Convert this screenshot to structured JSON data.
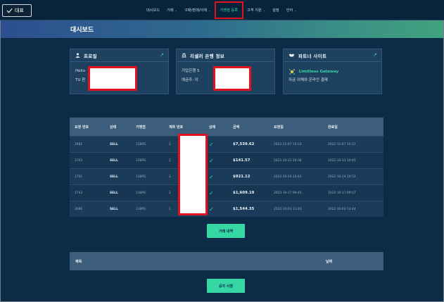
{
  "nav": {
    "brand": "대표",
    "items": [
      {
        "label": "대시보드",
        "caret": ""
      },
      {
        "label": "거래",
        "caret": "⌄"
      },
      {
        "label": "구매/판매/이체",
        "caret": "⌄"
      },
      {
        "label": "가맹점 등록",
        "caret": ""
      },
      {
        "label": "고객 지원",
        "caret": "⌄"
      },
      {
        "label": "설정",
        "caret": ""
      },
      {
        "label": "언어",
        "caret": "⌄"
      }
    ]
  },
  "hero": {
    "title": "대시보드"
  },
  "cards": {
    "profile": {
      "title": "프로필",
      "line1": "Hello",
      "line2": "TU 판"
    },
    "bank": {
      "title": "리셀러 은행 정보",
      "line1": "기업은행 5",
      "line2": "예금주: 이"
    },
    "partner": {
      "title": "파트너 사이트",
      "name": "Limitless Gateway",
      "desc": "자금 이체와 온라인 결제"
    }
  },
  "table": {
    "headers": [
      "요청 번호",
      "상태",
      "가맹점",
      "계좌 번호",
      "상태",
      "금액",
      "요청일",
      "완료일"
    ],
    "rows": [
      {
        "id": "2881",
        "status": "SELL",
        "merchant": "138PG",
        "acct": "2",
        "amount": "$7,539.62",
        "requested": "2022-11-07 10:33",
        "completed": "2022-11-07 10:37"
      },
      {
        "id": "2763",
        "status": "SELL",
        "merchant": "138PG",
        "acct": "2",
        "amount": "$141.57",
        "requested": "2022-10-31 10:38",
        "completed": "2022-10-31 10:45"
      },
      {
        "id": "2701",
        "status": "SELL",
        "merchant": "138PG",
        "acct": "2",
        "amount": "$921.12",
        "requested": "2022-10-24 10:43",
        "completed": "2022-10-24 10:52"
      },
      {
        "id": "2743",
        "status": "SELL",
        "merchant": "138PG",
        "acct": "2",
        "amount": "$1,609.19",
        "requested": "2022-10-17 09:45",
        "completed": "2022-10-17 09:57"
      },
      {
        "id": "2686",
        "status": "SELL",
        "merchant": "138PG",
        "acct": "2",
        "amount": "$1,544.35",
        "requested": "2022-10-03 13:43",
        "completed": "2022-10-03 13:44"
      }
    ]
  },
  "buttons": {
    "history": "거래 내역",
    "notices": "공지 사항"
  },
  "notice_bar": {
    "title": "제목",
    "date": "날짜"
  },
  "colors": {
    "accent": "#36d6a5",
    "redaction": "#e0121f"
  }
}
